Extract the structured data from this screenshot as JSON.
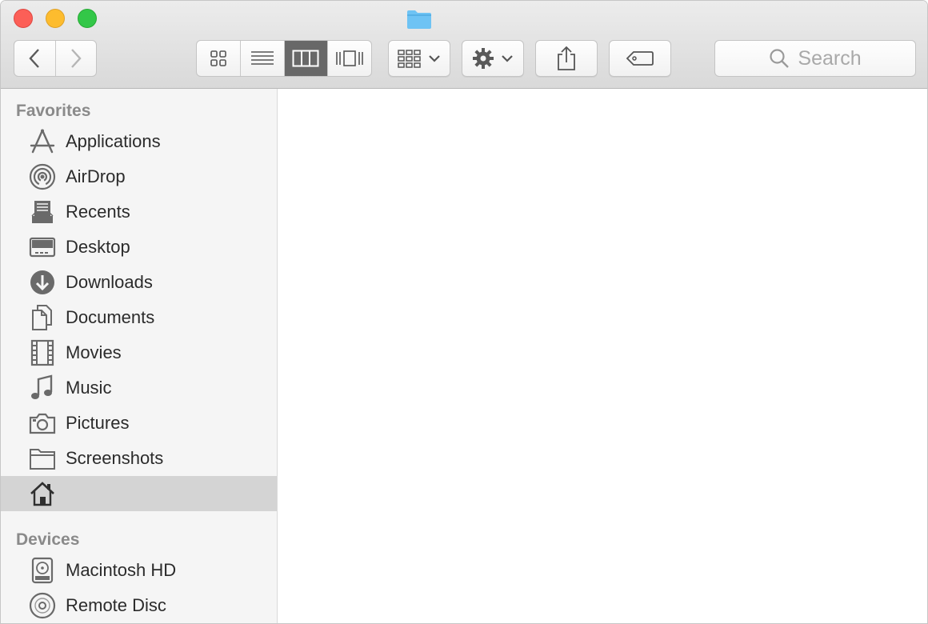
{
  "toolbar": {
    "search_placeholder": "Search"
  },
  "sidebar": {
    "favorites_heading": "Favorites",
    "favorites": [
      {
        "label": "Applications",
        "icon": "applications-icon"
      },
      {
        "label": "AirDrop",
        "icon": "airdrop-icon"
      },
      {
        "label": "Recents",
        "icon": "recents-icon"
      },
      {
        "label": "Desktop",
        "icon": "desktop-icon"
      },
      {
        "label": "Downloads",
        "icon": "downloads-icon"
      },
      {
        "label": "Documents",
        "icon": "documents-icon"
      },
      {
        "label": "Movies",
        "icon": "movies-icon"
      },
      {
        "label": "Music",
        "icon": "music-icon"
      },
      {
        "label": "Pictures",
        "icon": "pictures-icon"
      },
      {
        "label": "Screenshots",
        "icon": "folder-icon"
      },
      {
        "label": "",
        "icon": "home-icon",
        "selected": true
      }
    ],
    "devices_heading": "Devices",
    "devices": [
      {
        "label": "Macintosh HD",
        "icon": "hard-drive-icon"
      },
      {
        "label": "Remote Disc",
        "icon": "remote-disc-icon"
      }
    ]
  },
  "colors": {
    "close": "#fc5f57",
    "minimize": "#fdbc2e",
    "maximize": "#33c748",
    "folder_accent": "#6ec3f4",
    "selected_row": "#d4d4d4",
    "active_view": "#686868"
  }
}
